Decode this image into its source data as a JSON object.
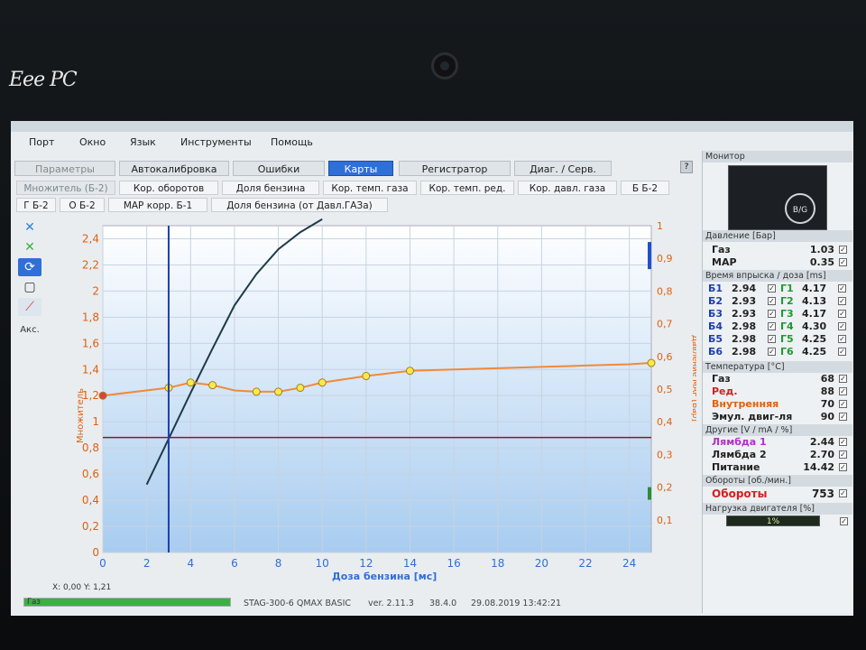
{
  "brand": "Eee PC",
  "menu": [
    "Порт",
    "Окно",
    "Язык",
    "Инструменты",
    "Помощь"
  ],
  "main_tabs": [
    {
      "label": "Параметры",
      "active": false
    },
    {
      "label": "Автокалибровка",
      "active": false
    },
    {
      "label": "Ошибки",
      "active": false
    },
    {
      "label": "Карты",
      "active": true
    },
    {
      "label": "Регистратор",
      "active": false
    },
    {
      "label": "Диаг. / Серв.",
      "active": false
    }
  ],
  "sub_tabs_row1": [
    "Множитель (Б-2)",
    "Кор. оборотов",
    "Доля бензина",
    "Кор. темп. газа",
    "Кор. темп. ред.",
    "Кор. давл. газа",
    "Б Б-2"
  ],
  "sub_tabs_row2": [
    "Г Б-2",
    "О Б-2",
    "MAP корр. Б-1",
    "Доля бензина (от Давл.ГАЗа)"
  ],
  "toolbar": {
    "icons": [
      "close-x-icon",
      "close-x-green-icon",
      "refresh-icon",
      "square-icon",
      "chart-icon"
    ],
    "label": "Акс."
  },
  "chart_data": {
    "type": "line",
    "xlabel": "Доза бензина [мс]",
    "ylabel": "Множитель",
    "y2label": "Давление MAP [Бар]",
    "xlim": [
      0,
      25
    ],
    "ylim": [
      0.4,
      2.4
    ],
    "y2lim": [
      0,
      1
    ],
    "xticks": [
      "0",
      "2",
      "4",
      "6",
      "8",
      "10",
      "12",
      "14",
      "16",
      "18",
      "20",
      "22",
      "24"
    ],
    "yticks": [
      "0",
      "0,2",
      "0,4",
      "0,6",
      "0,8",
      "1",
      "1,2",
      "1,4",
      "1,6",
      "1,8",
      "2",
      "2,2",
      "2,4"
    ],
    "y2ticks": [
      "0,1",
      "0,2",
      "0,3",
      "0,4",
      "0,5",
      "0,6",
      "0,7",
      "0,8",
      "0,9",
      "1"
    ],
    "multiplier_curve": {
      "x": [
        0,
        3,
        4,
        5,
        6,
        7,
        8,
        9,
        10,
        12,
        14,
        16,
        18,
        20,
        22,
        24,
        25
      ],
      "y": [
        1.2,
        1.26,
        1.3,
        1.28,
        1.24,
        1.23,
        1.23,
        1.26,
        1.3,
        1.35,
        1.39,
        1.4,
        1.41,
        1.42,
        1.43,
        1.44,
        1.45
      ]
    },
    "map_curve": {
      "x": [
        2,
        3,
        4,
        5,
        6,
        7,
        8,
        9,
        10
      ],
      "y": [
        0.52,
        0.87,
        1.22,
        1.56,
        1.89,
        2.13,
        2.32,
        2.45,
        2.55
      ]
    },
    "vertical_cursor_x": 3.0,
    "horizontal_line_y": 0.88,
    "status_xy": "X: 0,00   Y: 1,21"
  },
  "status": {
    "device": "STAG-300-6 QMAX BASIC",
    "version": "ver. 2.11.3",
    "build": "38.4.0",
    "datetime": "29.08.2019 13:42:21",
    "progress_label": "Газ",
    "progress": 1.0
  },
  "monitor": {
    "title": "Монитор",
    "mode_button": "B/G",
    "pressure_head": "Давление [Бар]",
    "pressure": [
      {
        "label": "Газ",
        "value": "1.03"
      },
      {
        "label": "MAP",
        "value": "0.35"
      }
    ],
    "inj_head": "Время впрыска / доза [ms]",
    "injectors": [
      {
        "b": "Б1",
        "bv": "2.94",
        "g": "Г1",
        "gv": "4.17"
      },
      {
        "b": "Б2",
        "bv": "2.93",
        "g": "Г2",
        "gv": "4.13"
      },
      {
        "b": "Б3",
        "bv": "2.93",
        "g": "Г3",
        "gv": "4.17"
      },
      {
        "b": "Б4",
        "bv": "2.98",
        "g": "Г4",
        "gv": "4.30"
      },
      {
        "b": "Б5",
        "bv": "2.98",
        "g": "Г5",
        "gv": "4.25"
      },
      {
        "b": "Б6",
        "bv": "2.98",
        "g": "Г6",
        "gv": "4.25"
      }
    ],
    "temp_head": "Температура [°C]",
    "temps": [
      {
        "label": "Газ",
        "value": "68"
      },
      {
        "label": "Ред.",
        "value": "88"
      },
      {
        "label": "Внутренняя",
        "value": "70"
      },
      {
        "label": "Эмул. двиг-ля",
        "value": "90"
      }
    ],
    "other_head": "Другие [V / mA / %]",
    "others": [
      {
        "label": "Лямбда 1",
        "value": "2.44"
      },
      {
        "label": "Лямбда 2",
        "value": "2.70"
      },
      {
        "label": "Питание",
        "value": "14.42"
      }
    ],
    "rpm_head": "Обороты [об./мин.]",
    "rpm_label": "Обороты",
    "rpm_value": "753",
    "load_head": "Нагрузка двигателя [%]",
    "load_value": "1%"
  }
}
